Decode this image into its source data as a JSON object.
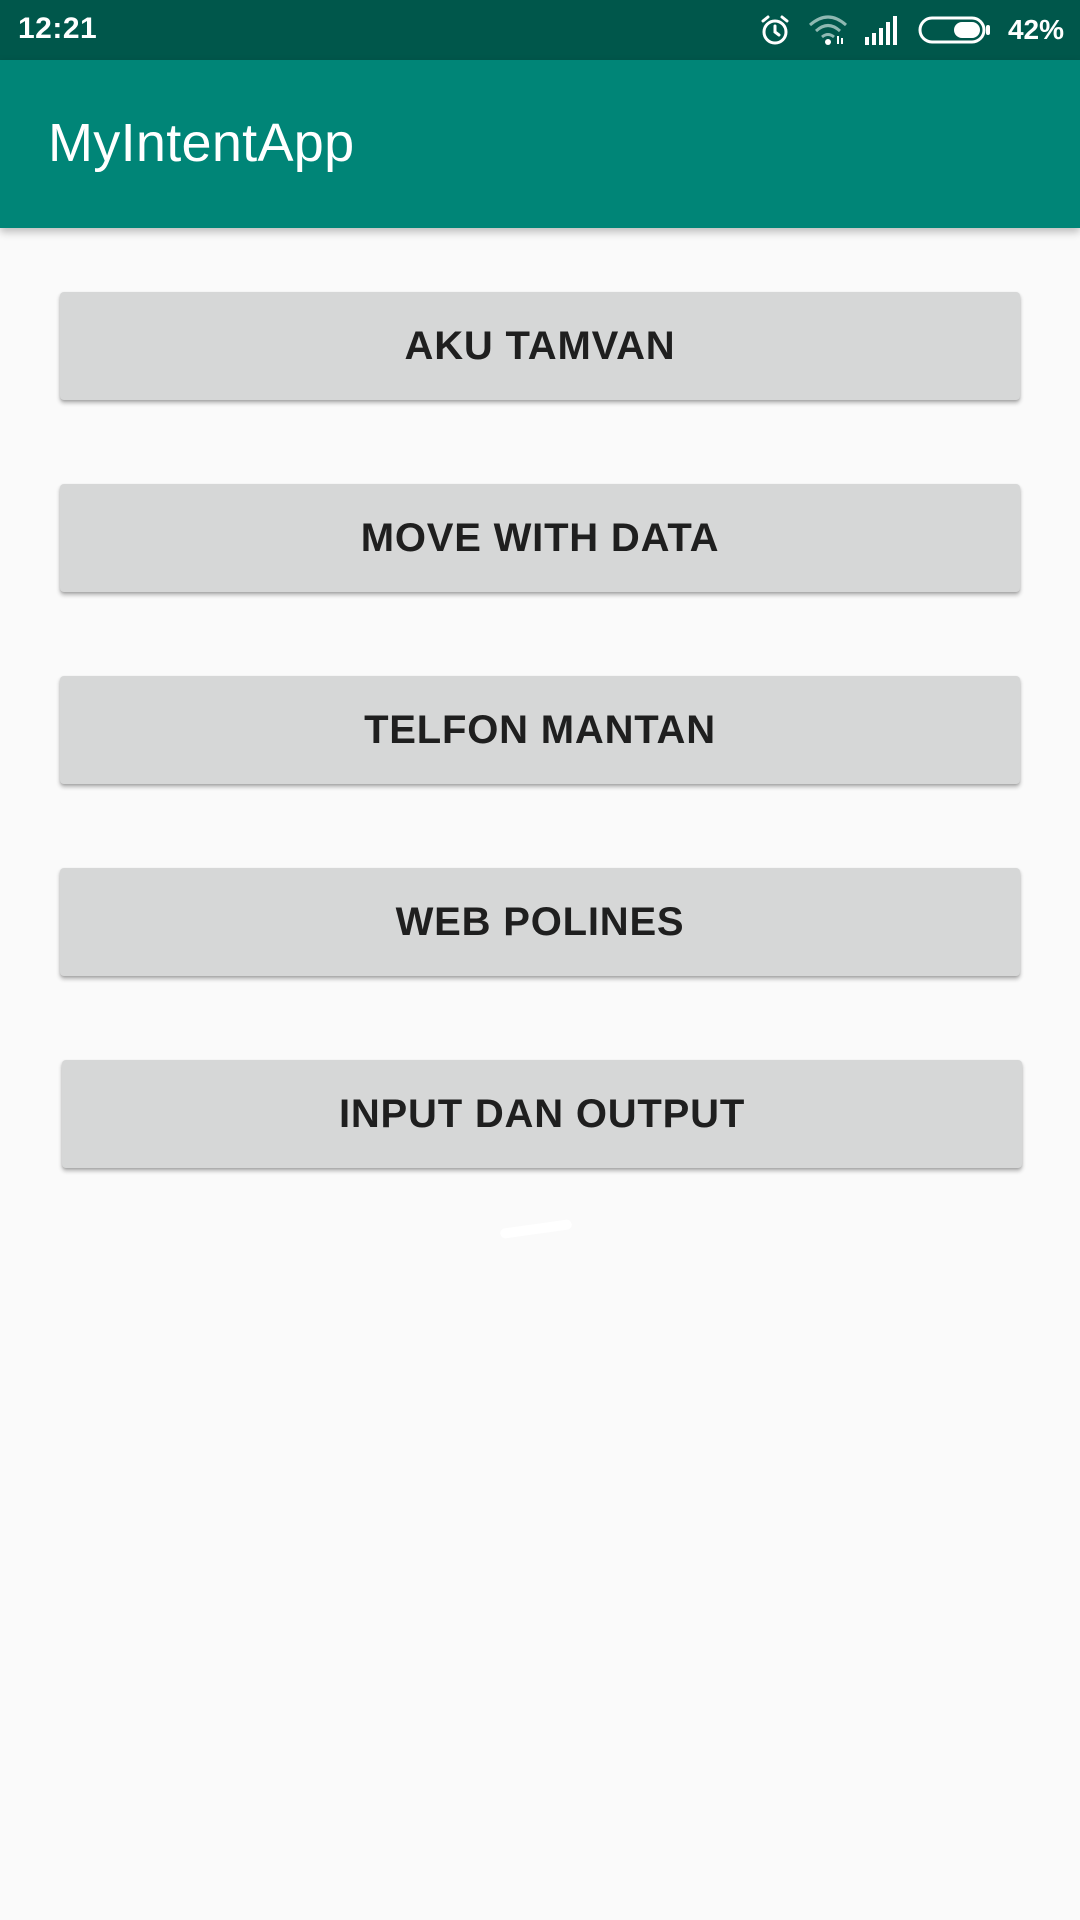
{
  "status_bar": {
    "time": "12:21",
    "battery": "42%",
    "icons": [
      "alarm-icon",
      "wifi-icon",
      "signal-icon",
      "battery-icon"
    ]
  },
  "app_bar": {
    "title": "MyIntentApp"
  },
  "buttons": [
    {
      "label": "AKU TAMVAN"
    },
    {
      "label": "MOVE WITH DATA"
    },
    {
      "label": "TELFON MANTAN"
    },
    {
      "label": "WEB POLINES"
    },
    {
      "label": "INPUT DAN OUTPUT"
    }
  ],
  "colors": {
    "status_bar": "#00574b",
    "app_bar": "#008577",
    "background": "#fafafa",
    "button": "#d6d7d7",
    "button_text": "#1f1f1f"
  }
}
